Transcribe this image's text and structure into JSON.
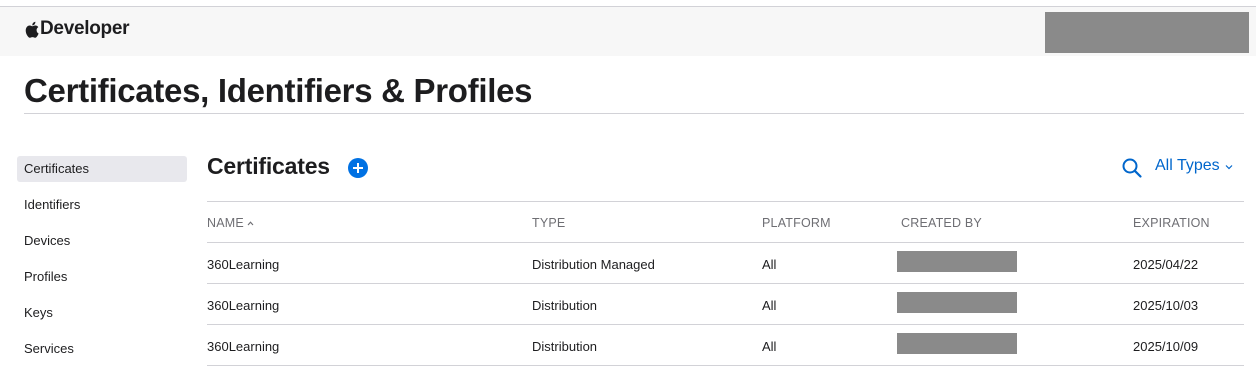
{
  "nav": {
    "brand_label": "Developer",
    "apple_icon": "apple-logo-icon"
  },
  "page": {
    "title": "Certificates, Identifiers & Profiles"
  },
  "sidebar": {
    "items": [
      {
        "label": "Certificates",
        "active": true
      },
      {
        "label": "Identifiers",
        "active": false
      },
      {
        "label": "Devices",
        "active": false
      },
      {
        "label": "Profiles",
        "active": false
      },
      {
        "label": "Keys",
        "active": false
      },
      {
        "label": "Services",
        "active": false
      }
    ]
  },
  "main": {
    "section_title": "Certificates",
    "add_icon": "plus-circle-icon",
    "search_icon": "search-icon",
    "filter_label": "All Types",
    "accent_color": "#0066cc",
    "table": {
      "columns": [
        "NAME",
        "TYPE",
        "PLATFORM",
        "CREATED BY",
        "EXPIRATION"
      ],
      "sorted_column": "NAME",
      "sort_direction": "ascending",
      "rows": [
        {
          "name": "360Learning",
          "type": "Distribution Managed",
          "platform": "All",
          "expiration": "2025/04/22"
        },
        {
          "name": "360Learning",
          "type": "Distribution",
          "platform": "All",
          "expiration": "2025/10/03"
        },
        {
          "name": "360Learning",
          "type": "Distribution",
          "platform": "All",
          "expiration": "2025/10/09"
        }
      ]
    }
  }
}
